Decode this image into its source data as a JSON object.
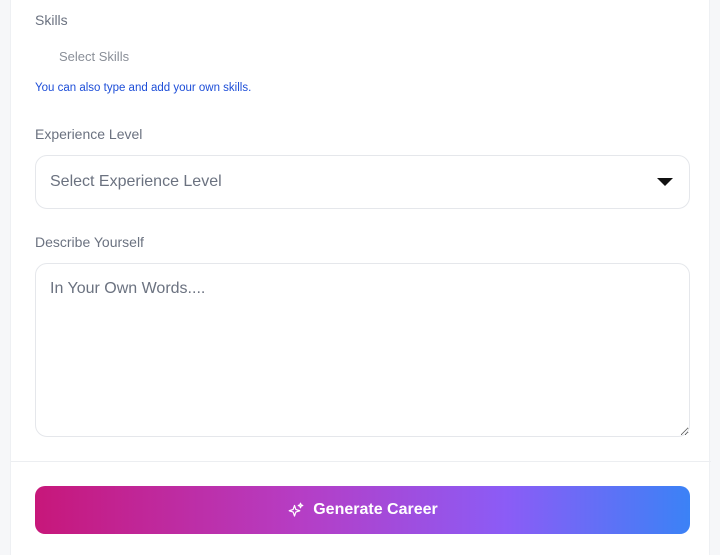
{
  "form": {
    "skills": {
      "label": "Skills",
      "placeholder": "Select Skills",
      "hint": "You can also type and add your own skills."
    },
    "experience": {
      "label": "Experience Level",
      "placeholder": "Select Experience Level",
      "icon": "caret-down-icon"
    },
    "describe": {
      "label": "Describe Yourself",
      "placeholder": "In Your Own Words...."
    },
    "submit": {
      "label": "Generate Career",
      "icon": "sparkles-icon"
    }
  },
  "colors": {
    "hint": "#1d4ed8",
    "button_gradient": [
      "#c7177a",
      "#b63dc4",
      "#8b5cf6",
      "#3b82f6"
    ]
  }
}
